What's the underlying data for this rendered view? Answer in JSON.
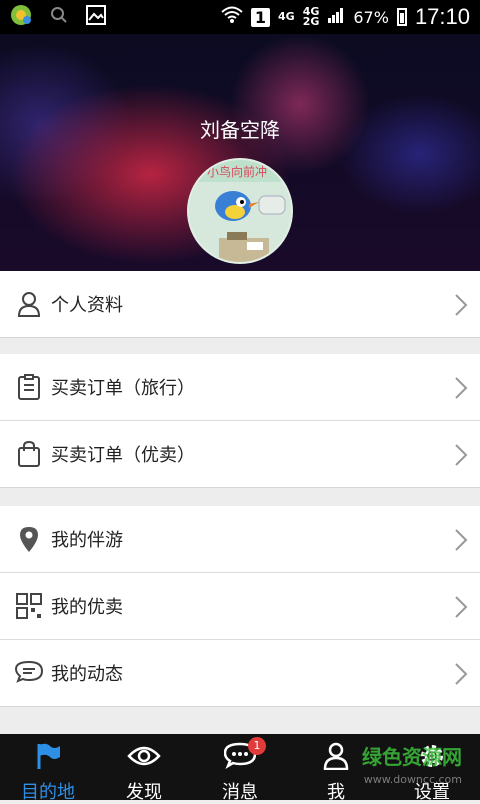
{
  "status_bar": {
    "network_top": "4G",
    "network_mid": "4G",
    "network_bottom": "2G",
    "sim_slot": "1",
    "battery": "67%",
    "time": "17:10"
  },
  "header": {
    "username": "刘备空降"
  },
  "menu": {
    "profile": "个人资料",
    "orders_travel": "买卖订单（旅行）",
    "orders_youmai": "买卖订单（优卖）",
    "my_companion": "我的伴游",
    "my_youmai": "我的优卖",
    "my_moments": "我的动态"
  },
  "tabs": [
    {
      "label": "目的地"
    },
    {
      "label": "发现"
    },
    {
      "label": "消息",
      "badge": "1"
    },
    {
      "label": "我"
    },
    {
      "label": "设置"
    }
  ],
  "watermark": {
    "text": "绿色资源网",
    "url": "www.downcc.com"
  },
  "colors": {
    "accent": "#2d8fe6",
    "badge": "#e23b3b",
    "tabbar": "#121212"
  }
}
